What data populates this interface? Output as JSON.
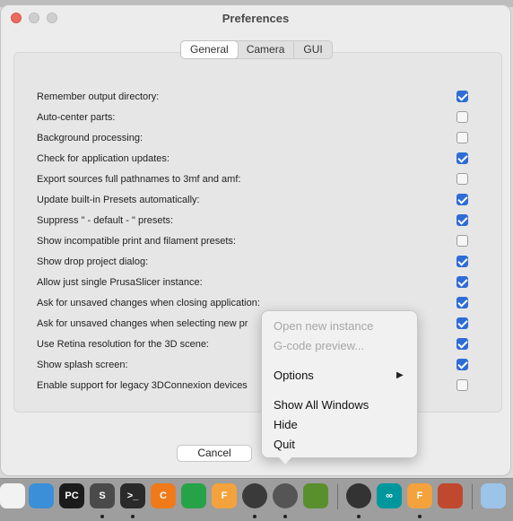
{
  "window": {
    "title": "Preferences",
    "tabs": [
      {
        "label": "General",
        "selected": true
      },
      {
        "label": "Camera",
        "selected": false
      },
      {
        "label": "GUI",
        "selected": false
      }
    ]
  },
  "options": [
    {
      "label": "Remember output directory:",
      "checked": true
    },
    {
      "label": "Auto-center parts:",
      "checked": false
    },
    {
      "label": "Background processing:",
      "checked": false
    },
    {
      "label": "Check for application updates:",
      "checked": true
    },
    {
      "label": "Export sources full pathnames to 3mf and amf:",
      "checked": false
    },
    {
      "label": "Update built-in Presets automatically:",
      "checked": true
    },
    {
      "label": "Suppress \" - default - \" presets:",
      "checked": true
    },
    {
      "label": "Show incompatible print and filament presets:",
      "checked": false
    },
    {
      "label": "Show drop project dialog:",
      "checked": true
    },
    {
      "label": "Allow just single PrusaSlicer instance:",
      "checked": true
    },
    {
      "label": "Ask for unsaved changes when closing application:",
      "checked": true
    },
    {
      "label": "Ask for unsaved changes when selecting new pr",
      "checked": true
    },
    {
      "label": "Use Retina resolution for the 3D scene:",
      "checked": true
    },
    {
      "label": "Show splash screen:",
      "checked": true
    },
    {
      "label": "Enable support for legacy 3DConnexion devices",
      "checked": false
    }
  ],
  "buttons": {
    "cancel": "Cancel"
  },
  "context_menu": {
    "items": [
      {
        "label": "Open new instance",
        "enabled": false
      },
      {
        "label": "G-code preview...",
        "enabled": false
      },
      {
        "label": "Options",
        "enabled": true,
        "submenu": true
      },
      {
        "label": "Show All Windows",
        "enabled": true
      },
      {
        "label": "Hide",
        "enabled": true
      },
      {
        "label": "Quit",
        "enabled": true
      }
    ],
    "submenu_arrow": "▶"
  },
  "dock": {
    "items": [
      {
        "name": "pencil-app-icon",
        "text": "",
        "color": "#f2f2f2"
      },
      {
        "name": "elephant-app-icon",
        "text": "",
        "color": "#3a8fd8"
      },
      {
        "name": "pycharm-app-icon",
        "text": "PC",
        "color": "#1b1b1b"
      },
      {
        "name": "sublime-app-icon",
        "text": "S",
        "color": "#4a4a4a"
      },
      {
        "name": "terminal-app-icon",
        "text": ">_",
        "color": "#2a2a2a"
      },
      {
        "name": "c-app-icon",
        "text": "C",
        "color": "#f07a1a"
      },
      {
        "name": "network-app-icon",
        "text": "",
        "color": "#27a347"
      },
      {
        "name": "fusion-app-icon",
        "text": "F",
        "color": "#f4a23c"
      },
      {
        "name": "prusaslicer-app-icon",
        "text": "",
        "color": "#3a3a3a"
      },
      {
        "name": "prusaslicer-active-app-icon",
        "text": "",
        "color": "#555555"
      },
      {
        "name": "minecraft-app-icon",
        "text": "",
        "color": "#5a8f2e"
      },
      {
        "name": "camera-app-icon",
        "text": "",
        "color": "#333333"
      },
      {
        "name": "arduino-app-icon",
        "text": "∞",
        "color": "#00979c"
      },
      {
        "name": "fusion2-app-icon",
        "text": "F",
        "color": "#f4a23c"
      },
      {
        "name": "gem-app-icon",
        "text": "",
        "color": "#c0482f"
      },
      {
        "name": "downloads-folder-icon",
        "text": "",
        "color": "#9cc4e8"
      }
    ],
    "separator_label": ""
  }
}
